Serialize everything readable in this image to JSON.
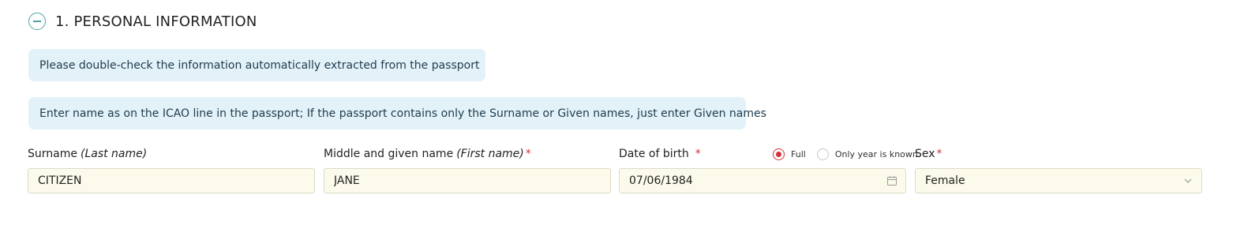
{
  "section": {
    "title": "1. PERSONAL INFORMATION",
    "collapse_icon": "minus-circle-icon"
  },
  "notices": {
    "double_check": "Please double-check the information automatically extracted from the passport",
    "icao_hint": "Enter name as on the ICAO line in the passport; If the passport contains only the Surname or Given names, just enter Given names"
  },
  "fields": {
    "surname": {
      "label": "Surname",
      "label_hint": "(Last name)",
      "value": "CITIZEN"
    },
    "given_name": {
      "label": "Middle and given name",
      "label_hint": "(First name)",
      "required_mark": "*",
      "value": "JANE"
    },
    "dob": {
      "label": "Date of birth",
      "required_mark": "*",
      "value": "07/06/1984",
      "icon": "calendar-icon",
      "options": [
        {
          "label": "Full",
          "selected": true
        },
        {
          "label": "Only year is known",
          "selected": false
        }
      ]
    },
    "sex": {
      "label": "Sex",
      "required_mark": "*",
      "value": "Female",
      "icon": "chevron-down-icon"
    }
  },
  "colors": {
    "accent": "#4ba3a8",
    "required": "#d4313a",
    "notice_bg": "#e3f2f8",
    "input_bg": "#fcfaea"
  }
}
